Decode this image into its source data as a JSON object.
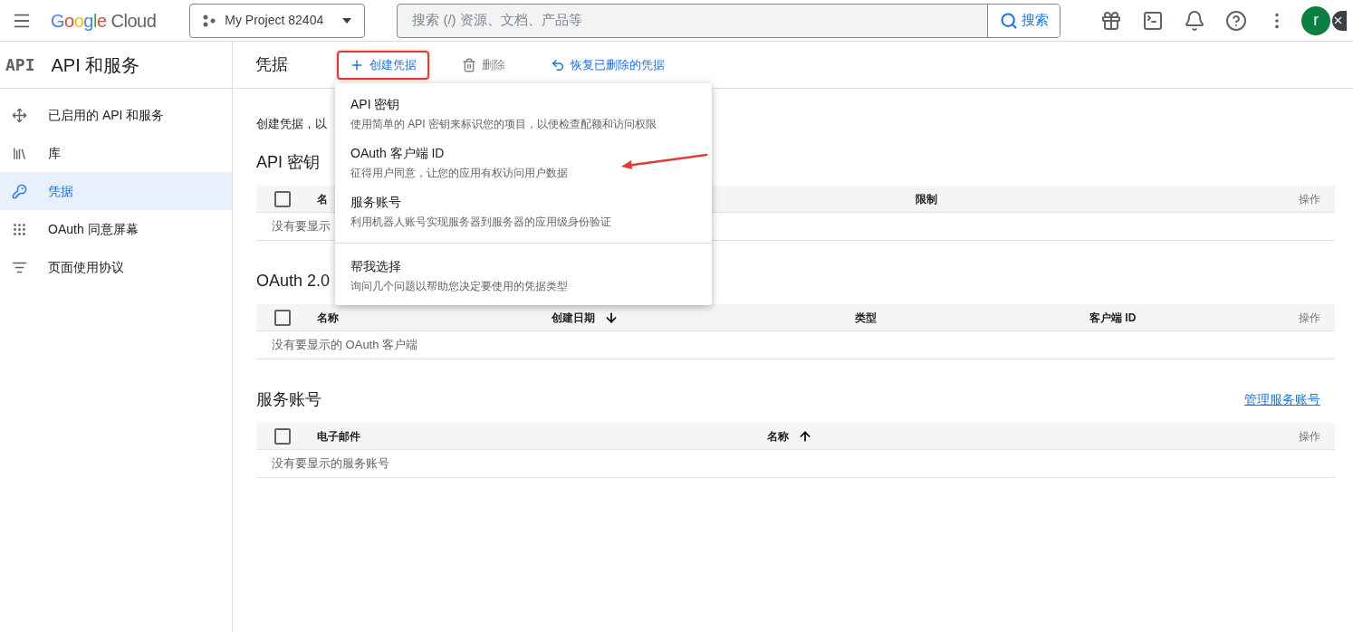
{
  "topbar": {
    "logo": "Google",
    "product": "Cloud",
    "project": "My Project 82404",
    "search": {
      "placeholder": "搜索 (/) 资源、文档、产品等",
      "button": "搜索"
    },
    "avatar": "r"
  },
  "sidebar": {
    "badge": "API",
    "title": "API 和服务",
    "items": [
      {
        "label": "已启用的 API 和服务",
        "selected": false
      },
      {
        "label": "库",
        "selected": false
      },
      {
        "label": "凭据",
        "selected": true
      },
      {
        "label": "OAuth 同意屏幕",
        "selected": false
      },
      {
        "label": "页面使用协议",
        "selected": false
      }
    ]
  },
  "toolbar": {
    "title": "凭据",
    "actions": [
      {
        "label": "创建凭据",
        "kind": "create",
        "disabled": false,
        "annotated": true
      },
      {
        "label": "删除",
        "kind": "delete",
        "disabled": true,
        "annotated": false
      },
      {
        "label": "恢复已删除的凭据",
        "kind": "restore",
        "disabled": false,
        "annotated": false
      }
    ]
  },
  "description": "创建凭据，以",
  "sections": [
    {
      "title": "API 密钥",
      "all_checked": false,
      "columns": [
        {
          "label": "名",
          "kind": "plain"
        },
        {
          "label": "限制",
          "kind": "plain"
        },
        {
          "label": "操作",
          "kind": "plain"
        }
      ],
      "empty": "没有要显示"
    },
    {
      "title": "OAuth 2.0",
      "all_checked": false,
      "columns": [
        {
          "label": "名称",
          "kind": "plain"
        },
        {
          "label": "创建日期",
          "kind": "descending"
        },
        {
          "label": "类型",
          "kind": "plain"
        },
        {
          "label": "客户端 ID",
          "kind": "plain"
        },
        {
          "label": "操作",
          "kind": "plain"
        }
      ],
      "empty": "没有要显示的 OAuth 客户端"
    },
    {
      "title": "服务账号",
      "all_checked": false,
      "link": "管理服务账号",
      "columns": [
        {
          "label": "电子邮件",
          "kind": "plain"
        },
        {
          "label": "名称",
          "kind": "ascending"
        },
        {
          "label": "操作",
          "kind": "plain"
        }
      ],
      "empty": "没有要显示的服务账号"
    }
  ],
  "menu": {
    "groups": [
      [
        {
          "title": "API 密钥",
          "subtitle": "使用简单的 API 密钥来标识您的项目，以便检查配额和访问权限"
        },
        {
          "title": "OAuth 客户端 ID",
          "subtitle": "征得用户同意，让您的应用有权访问用户数据"
        },
        {
          "title": "服务账号",
          "subtitle": "利用机器人账号实现服务器到服务器的应用级身份验证"
        }
      ],
      [
        {
          "title": "帮我选择",
          "subtitle": "询问几个问题以帮助您决定要使用的凭据类型"
        }
      ]
    ]
  }
}
